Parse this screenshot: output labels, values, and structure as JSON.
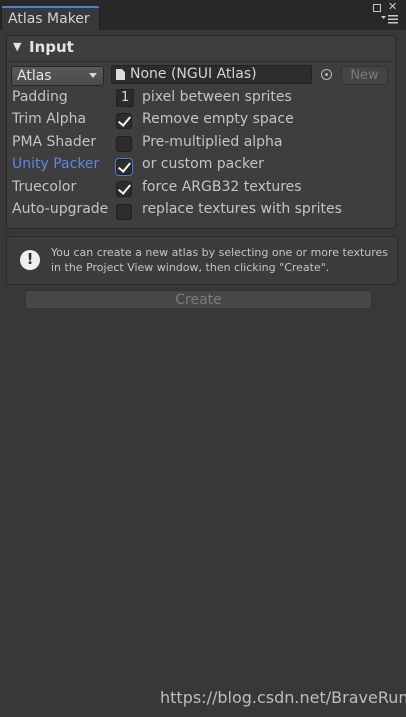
{
  "window": {
    "tab_title": "Atlas Maker",
    "icons": [
      "maximize-icon",
      "close-icon",
      "menu-icon"
    ]
  },
  "input_section": {
    "title": "Input",
    "atlas_dropdown": "Atlas",
    "atlas_field": "None (NGUI Atlas)",
    "new_button": "New",
    "rows": [
      {
        "label": "Padding",
        "value": "1",
        "description": "pixel between sprites"
      },
      {
        "label": "Trim Alpha",
        "checked": true,
        "description": "Remove empty space"
      },
      {
        "label": "PMA Shader",
        "checked": false,
        "description": "Pre-multiplied alpha"
      },
      {
        "label": "Unity Packer",
        "checked": true,
        "description": "or custom packer"
      },
      {
        "label": "Truecolor",
        "checked": true,
        "description": "force ARGB32 textures"
      },
      {
        "label": "Auto-upgrade",
        "checked": false,
        "description": "replace textures with sprites"
      }
    ]
  },
  "help": {
    "message": "You can create a new atlas by selecting one or more textures in the Project View window, then clicking \"Create\"."
  },
  "create_button": "Create",
  "watermark": "https://blog.csdn.net/BraveRunTo",
  "colors": {
    "accent": "#4a82d4",
    "link_label": "#5c87e6",
    "background": "#383838"
  }
}
